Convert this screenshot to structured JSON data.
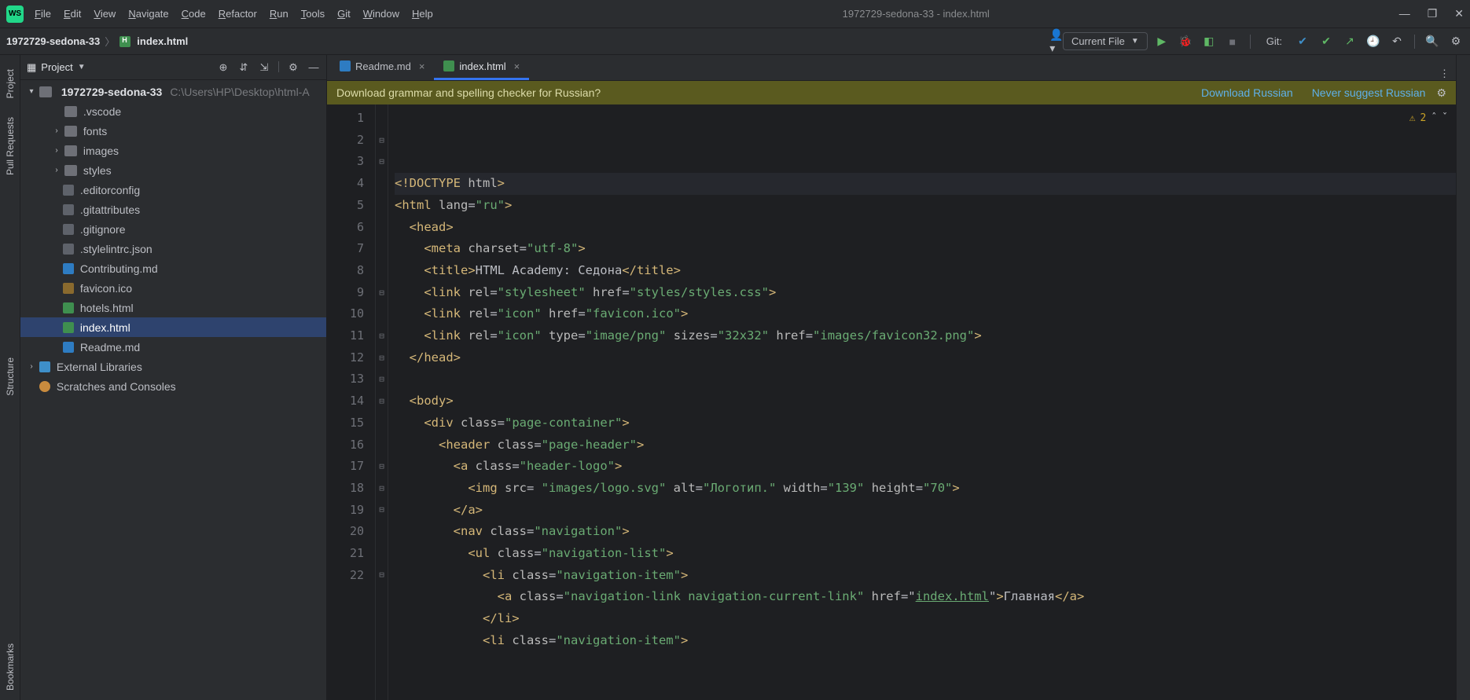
{
  "window": {
    "title": "1972729-sedona-33 - index.html"
  },
  "menu": [
    "File",
    "Edit",
    "View",
    "Navigate",
    "Code",
    "Refactor",
    "Run",
    "Tools",
    "Git",
    "Window",
    "Help"
  ],
  "breadcrumb": {
    "root": "1972729-sedona-33",
    "file": "index.html"
  },
  "runConfig": "Current File",
  "gitLabel": "Git:",
  "projectPanel": {
    "title": "Project",
    "root": {
      "name": "1972729-sedona-33",
      "path": "C:\\Users\\HP\\Desktop\\html-A"
    },
    "folders": [
      ".vscode",
      "fonts",
      "images",
      "styles"
    ],
    "files": [
      {
        "name": ".editorconfig",
        "kind": "cfg"
      },
      {
        "name": ".gitattributes",
        "kind": "cfg"
      },
      {
        "name": ".gitignore",
        "kind": "cfg"
      },
      {
        "name": ".stylelintrc.json",
        "kind": "json"
      },
      {
        "name": "Contributing.md",
        "kind": "md"
      },
      {
        "name": "favicon.ico",
        "kind": "ico"
      },
      {
        "name": "hotels.html",
        "kind": "html"
      },
      {
        "name": "index.html",
        "kind": "html",
        "selected": true
      },
      {
        "name": "Readme.md",
        "kind": "md"
      }
    ],
    "extLib": "External Libraries",
    "scratches": "Scratches and Consoles"
  },
  "tabs": [
    {
      "name": "Readme.md",
      "kind": "md",
      "active": false
    },
    {
      "name": "index.html",
      "kind": "html",
      "active": true
    }
  ],
  "banner": {
    "msg": "Download grammar and spelling checker for Russian?",
    "link1": "Download Russian",
    "link2": "Never suggest Russian"
  },
  "inspections": {
    "warnCount": "2"
  },
  "leftStrip": [
    "Project",
    "Pull Requests",
    "Structure",
    "Bookmarks"
  ],
  "code": {
    "lines": [
      {
        "n": 1,
        "mark": "",
        "seg": [
          [
            "doctype",
            "<!DOCTYPE "
          ],
          [
            "attr",
            "html"
          ],
          [
            "doctype",
            ">"
          ]
        ],
        "indent": 0,
        "hl": true
      },
      {
        "n": 2,
        "mark": "⊟",
        "seg": [
          [
            "tag",
            "<html "
          ],
          [
            "attr",
            "lang"
          ],
          [
            "punc",
            "="
          ],
          [
            "str",
            "\"ru\""
          ],
          [
            "tag",
            ">"
          ]
        ],
        "indent": 0
      },
      {
        "n": 3,
        "mark": "⊟",
        "seg": [
          [
            "tag",
            "<head>"
          ]
        ],
        "indent": 1
      },
      {
        "n": 4,
        "mark": "",
        "seg": [
          [
            "tag",
            "<meta "
          ],
          [
            "attr",
            "charset"
          ],
          [
            "punc",
            "="
          ],
          [
            "str",
            "\"utf-8\""
          ],
          [
            "tag",
            ">"
          ]
        ],
        "indent": 2
      },
      {
        "n": 5,
        "mark": "",
        "seg": [
          [
            "tag",
            "<title>"
          ],
          [
            "text",
            "HTML Academy: Седона"
          ],
          [
            "tag",
            "</title>"
          ]
        ],
        "indent": 2
      },
      {
        "n": 6,
        "mark": "",
        "seg": [
          [
            "tag",
            "<link "
          ],
          [
            "attr",
            "rel"
          ],
          [
            "punc",
            "="
          ],
          [
            "str",
            "\"stylesheet\""
          ],
          [
            "punc",
            " "
          ],
          [
            "attr",
            "href"
          ],
          [
            "punc",
            "="
          ],
          [
            "str",
            "\"styles/styles.css\""
          ],
          [
            "tag",
            ">"
          ]
        ],
        "indent": 2
      },
      {
        "n": 7,
        "mark": "",
        "seg": [
          [
            "tag",
            "<link "
          ],
          [
            "attr",
            "rel"
          ],
          [
            "punc",
            "="
          ],
          [
            "str",
            "\"icon\""
          ],
          [
            "punc",
            " "
          ],
          [
            "attr",
            "href"
          ],
          [
            "punc",
            "="
          ],
          [
            "str",
            "\"favicon.ico\""
          ],
          [
            "tag",
            ">"
          ]
        ],
        "indent": 2
      },
      {
        "n": 8,
        "mark": "",
        "seg": [
          [
            "tag",
            "<link "
          ],
          [
            "attr",
            "rel"
          ],
          [
            "punc",
            "="
          ],
          [
            "str",
            "\"icon\""
          ],
          [
            "punc",
            " "
          ],
          [
            "attr",
            "type"
          ],
          [
            "punc",
            "="
          ],
          [
            "str",
            "\"image/png\""
          ],
          [
            "punc",
            " "
          ],
          [
            "attr",
            "sizes"
          ],
          [
            "punc",
            "="
          ],
          [
            "str",
            "\"32x32\""
          ],
          [
            "punc",
            " "
          ],
          [
            "attr",
            "href"
          ],
          [
            "punc",
            "="
          ],
          [
            "str",
            "\"images/favicon32.png\""
          ],
          [
            "tag",
            ">"
          ]
        ],
        "indent": 2
      },
      {
        "n": 9,
        "mark": "⊟",
        "seg": [
          [
            "tag",
            "</head>"
          ]
        ],
        "indent": 1
      },
      {
        "n": 10,
        "mark": "",
        "seg": [],
        "indent": 0
      },
      {
        "n": 11,
        "mark": "⊟",
        "seg": [
          [
            "tag",
            "<body>"
          ]
        ],
        "indent": 1
      },
      {
        "n": 12,
        "mark": "⊟",
        "seg": [
          [
            "tag",
            "<div "
          ],
          [
            "attr",
            "class"
          ],
          [
            "punc",
            "="
          ],
          [
            "str",
            "\"page-container\""
          ],
          [
            "tag",
            ">"
          ]
        ],
        "indent": 2
      },
      {
        "n": 13,
        "mark": "⊟",
        "seg": [
          [
            "tag",
            "<header "
          ],
          [
            "attr",
            "class"
          ],
          [
            "punc",
            "="
          ],
          [
            "str",
            "\"page-header\""
          ],
          [
            "tag",
            ">"
          ]
        ],
        "indent": 3
      },
      {
        "n": 14,
        "mark": "⊟",
        "seg": [
          [
            "tag",
            "<a "
          ],
          [
            "attr",
            "class"
          ],
          [
            "punc",
            "="
          ],
          [
            "str",
            "\"header-logo\""
          ],
          [
            "tag",
            ">"
          ]
        ],
        "indent": 4
      },
      {
        "n": 15,
        "mark": "",
        "seg": [
          [
            "tag",
            "<img "
          ],
          [
            "attr",
            "src"
          ],
          [
            "punc",
            "= "
          ],
          [
            "str",
            "\"images/logo.svg\""
          ],
          [
            "punc",
            " "
          ],
          [
            "attr",
            "alt"
          ],
          [
            "punc",
            "="
          ],
          [
            "str",
            "\"Логотип.\""
          ],
          [
            "punc",
            " "
          ],
          [
            "attr",
            "width"
          ],
          [
            "punc",
            "="
          ],
          [
            "str",
            "\"139\""
          ],
          [
            "punc",
            " "
          ],
          [
            "attr",
            "height"
          ],
          [
            "punc",
            "="
          ],
          [
            "str",
            "\"70\""
          ],
          [
            "tag",
            ">"
          ]
        ],
        "indent": 5
      },
      {
        "n": 16,
        "mark": "",
        "seg": [
          [
            "tag",
            "</a>"
          ]
        ],
        "indent": 4
      },
      {
        "n": 17,
        "mark": "⊟",
        "seg": [
          [
            "tag",
            "<nav "
          ],
          [
            "attr",
            "class"
          ],
          [
            "punc",
            "="
          ],
          [
            "str",
            "\"navigation\""
          ],
          [
            "tag",
            ">"
          ]
        ],
        "indent": 4
      },
      {
        "n": 18,
        "mark": "⊟",
        "seg": [
          [
            "tag",
            "<ul "
          ],
          [
            "attr",
            "class"
          ],
          [
            "punc",
            "="
          ],
          [
            "str",
            "\"navigation-list\""
          ],
          [
            "tag",
            ">"
          ]
        ],
        "indent": 5
      },
      {
        "n": 19,
        "mark": "⊟",
        "seg": [
          [
            "tag",
            "<li "
          ],
          [
            "attr",
            "class"
          ],
          [
            "punc",
            "="
          ],
          [
            "str",
            "\"navigation-item\""
          ],
          [
            "tag",
            ">"
          ]
        ],
        "indent": 6
      },
      {
        "n": 20,
        "mark": "",
        "seg": [
          [
            "tag",
            "<a "
          ],
          [
            "attr",
            "class"
          ],
          [
            "punc",
            "="
          ],
          [
            "str",
            "\"navigation-link navigation-current-link\""
          ],
          [
            "punc",
            " "
          ],
          [
            "attr",
            "href"
          ],
          [
            "punc",
            "="
          ],
          [
            "punc",
            "\""
          ],
          [
            "linku",
            "index.html"
          ],
          [
            "punc",
            "\""
          ],
          [
            "tag",
            ">"
          ],
          [
            "text",
            "Главная"
          ],
          [
            "tag",
            "</a>"
          ]
        ],
        "indent": 7
      },
      {
        "n": 21,
        "mark": "",
        "seg": [
          [
            "tag",
            "</li>"
          ]
        ],
        "indent": 6
      },
      {
        "n": 22,
        "mark": "⊟",
        "seg": [
          [
            "tag",
            "<li "
          ],
          [
            "attr",
            "class"
          ],
          [
            "punc",
            "="
          ],
          [
            "str",
            "\"navigation-item\""
          ],
          [
            "tag",
            ">"
          ]
        ],
        "indent": 6
      }
    ]
  }
}
